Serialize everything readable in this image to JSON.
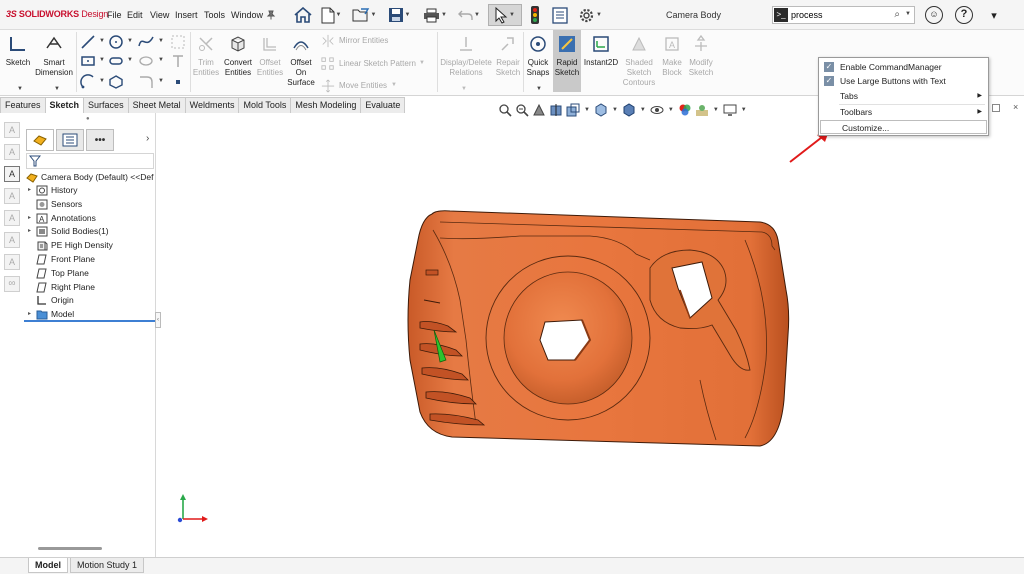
{
  "app": {
    "brand_ds": "3S",
    "brand_name": "SOLIDWORKS",
    "brand_suffix": "Design",
    "document_title": "Camera Body"
  },
  "menubar": {
    "items": [
      "File",
      "Edit",
      "View",
      "Insert",
      "Tools",
      "Window"
    ]
  },
  "search": {
    "value": "process"
  },
  "command_manager": {
    "sketch": "Sketch",
    "smart_dimension": [
      "Smart",
      "Dimension"
    ],
    "trim_entities": [
      "Trim",
      "Entities"
    ],
    "convert_entities": [
      "Convert",
      "Entities"
    ],
    "offset_entities": [
      "Offset",
      "Entities"
    ],
    "offset_on_surface": [
      "Offset",
      "On",
      "Surface"
    ],
    "mirror_entities": "Mirror Entities",
    "linear_sketch_pattern": "Linear Sketch Pattern",
    "move_entities": "Move Entities",
    "display_delete_relations": [
      "Display/Delete",
      "Relations"
    ],
    "repair_sketch": [
      "Repair",
      "Sketch"
    ],
    "quick_snaps": [
      "Quick",
      "Snaps"
    ],
    "rapid_sketch": [
      "Rapid",
      "Sketch"
    ],
    "instant2d": "Instant2D",
    "shaded_sketch_contours": [
      "Shaded",
      "Sketch",
      "Contours"
    ],
    "make_block": [
      "Make",
      "Block"
    ],
    "modify_sketch": [
      "Modify",
      "Sketch"
    ]
  },
  "tabs": [
    "Features",
    "Sketch",
    "Surfaces",
    "Sheet Metal",
    "Weldments",
    "Mold Tools",
    "Mesh Modeling",
    "Evaluate"
  ],
  "active_tab": "Sketch",
  "feature_tree": {
    "root": "Camera Body (Default) <<Def",
    "items": [
      {
        "label": "History",
        "expandable": true
      },
      {
        "label": "Sensors",
        "expandable": false
      },
      {
        "label": "Annotations",
        "expandable": true
      },
      {
        "label": "Solid Bodies(1)",
        "expandable": true
      },
      {
        "label": "PE High Density",
        "expandable": false
      },
      {
        "label": "Front Plane",
        "expandable": false
      },
      {
        "label": "Top Plane",
        "expandable": false
      },
      {
        "label": "Right Plane",
        "expandable": false
      },
      {
        "label": "Origin",
        "expandable": false
      },
      {
        "label": "Model",
        "expandable": true
      }
    ]
  },
  "context_menu": {
    "items": [
      {
        "label": "Enable CommandManager",
        "checked": true
      },
      {
        "label": "Use Large Buttons with Text",
        "checked": true
      },
      {
        "label": "Tabs",
        "submenu": true
      },
      {
        "label": "Toolbars",
        "submenu": true
      },
      {
        "label": "Customize...",
        "highlighted": true
      }
    ]
  },
  "bottom_tabs": [
    "Model",
    "Motion Study 1"
  ],
  "colors": {
    "part_orange": "#e0703a",
    "annotation_arrow": "#e11a1a",
    "selection_blue": "#3d7fd3",
    "brand_red": "#c8102e"
  }
}
